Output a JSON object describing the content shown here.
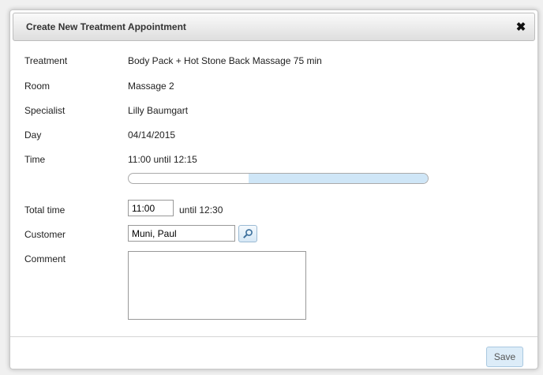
{
  "dialog": {
    "title": "Create New Treatment Appointment",
    "close_glyph": "✖"
  },
  "fields": {
    "treatment": {
      "label": "Treatment",
      "value": "Body Pack + Hot Stone Back Massage 75 min"
    },
    "room": {
      "label": "Room",
      "value": "Massage 2"
    },
    "specialist": {
      "label": "Specialist",
      "value": "Lilly Baumgart"
    },
    "day": {
      "label": "Day",
      "value": "04/14/2015"
    },
    "time": {
      "label": "Time",
      "value": "11:00 until 12:15"
    },
    "total_time": {
      "label": "Total time",
      "start": "11:00",
      "until": "until 12:30"
    },
    "customer": {
      "label": "Customer",
      "value": "Muni, Paul"
    },
    "comment": {
      "label": "Comment",
      "value": ""
    }
  },
  "time_slider": {
    "selected_start_fraction": 0.4,
    "selected_end_fraction": 1.0,
    "fill_color": "#cfe6f7"
  },
  "footer": {
    "save_label": "Save"
  },
  "icons": {
    "close": "close-icon",
    "search": "search-icon"
  }
}
